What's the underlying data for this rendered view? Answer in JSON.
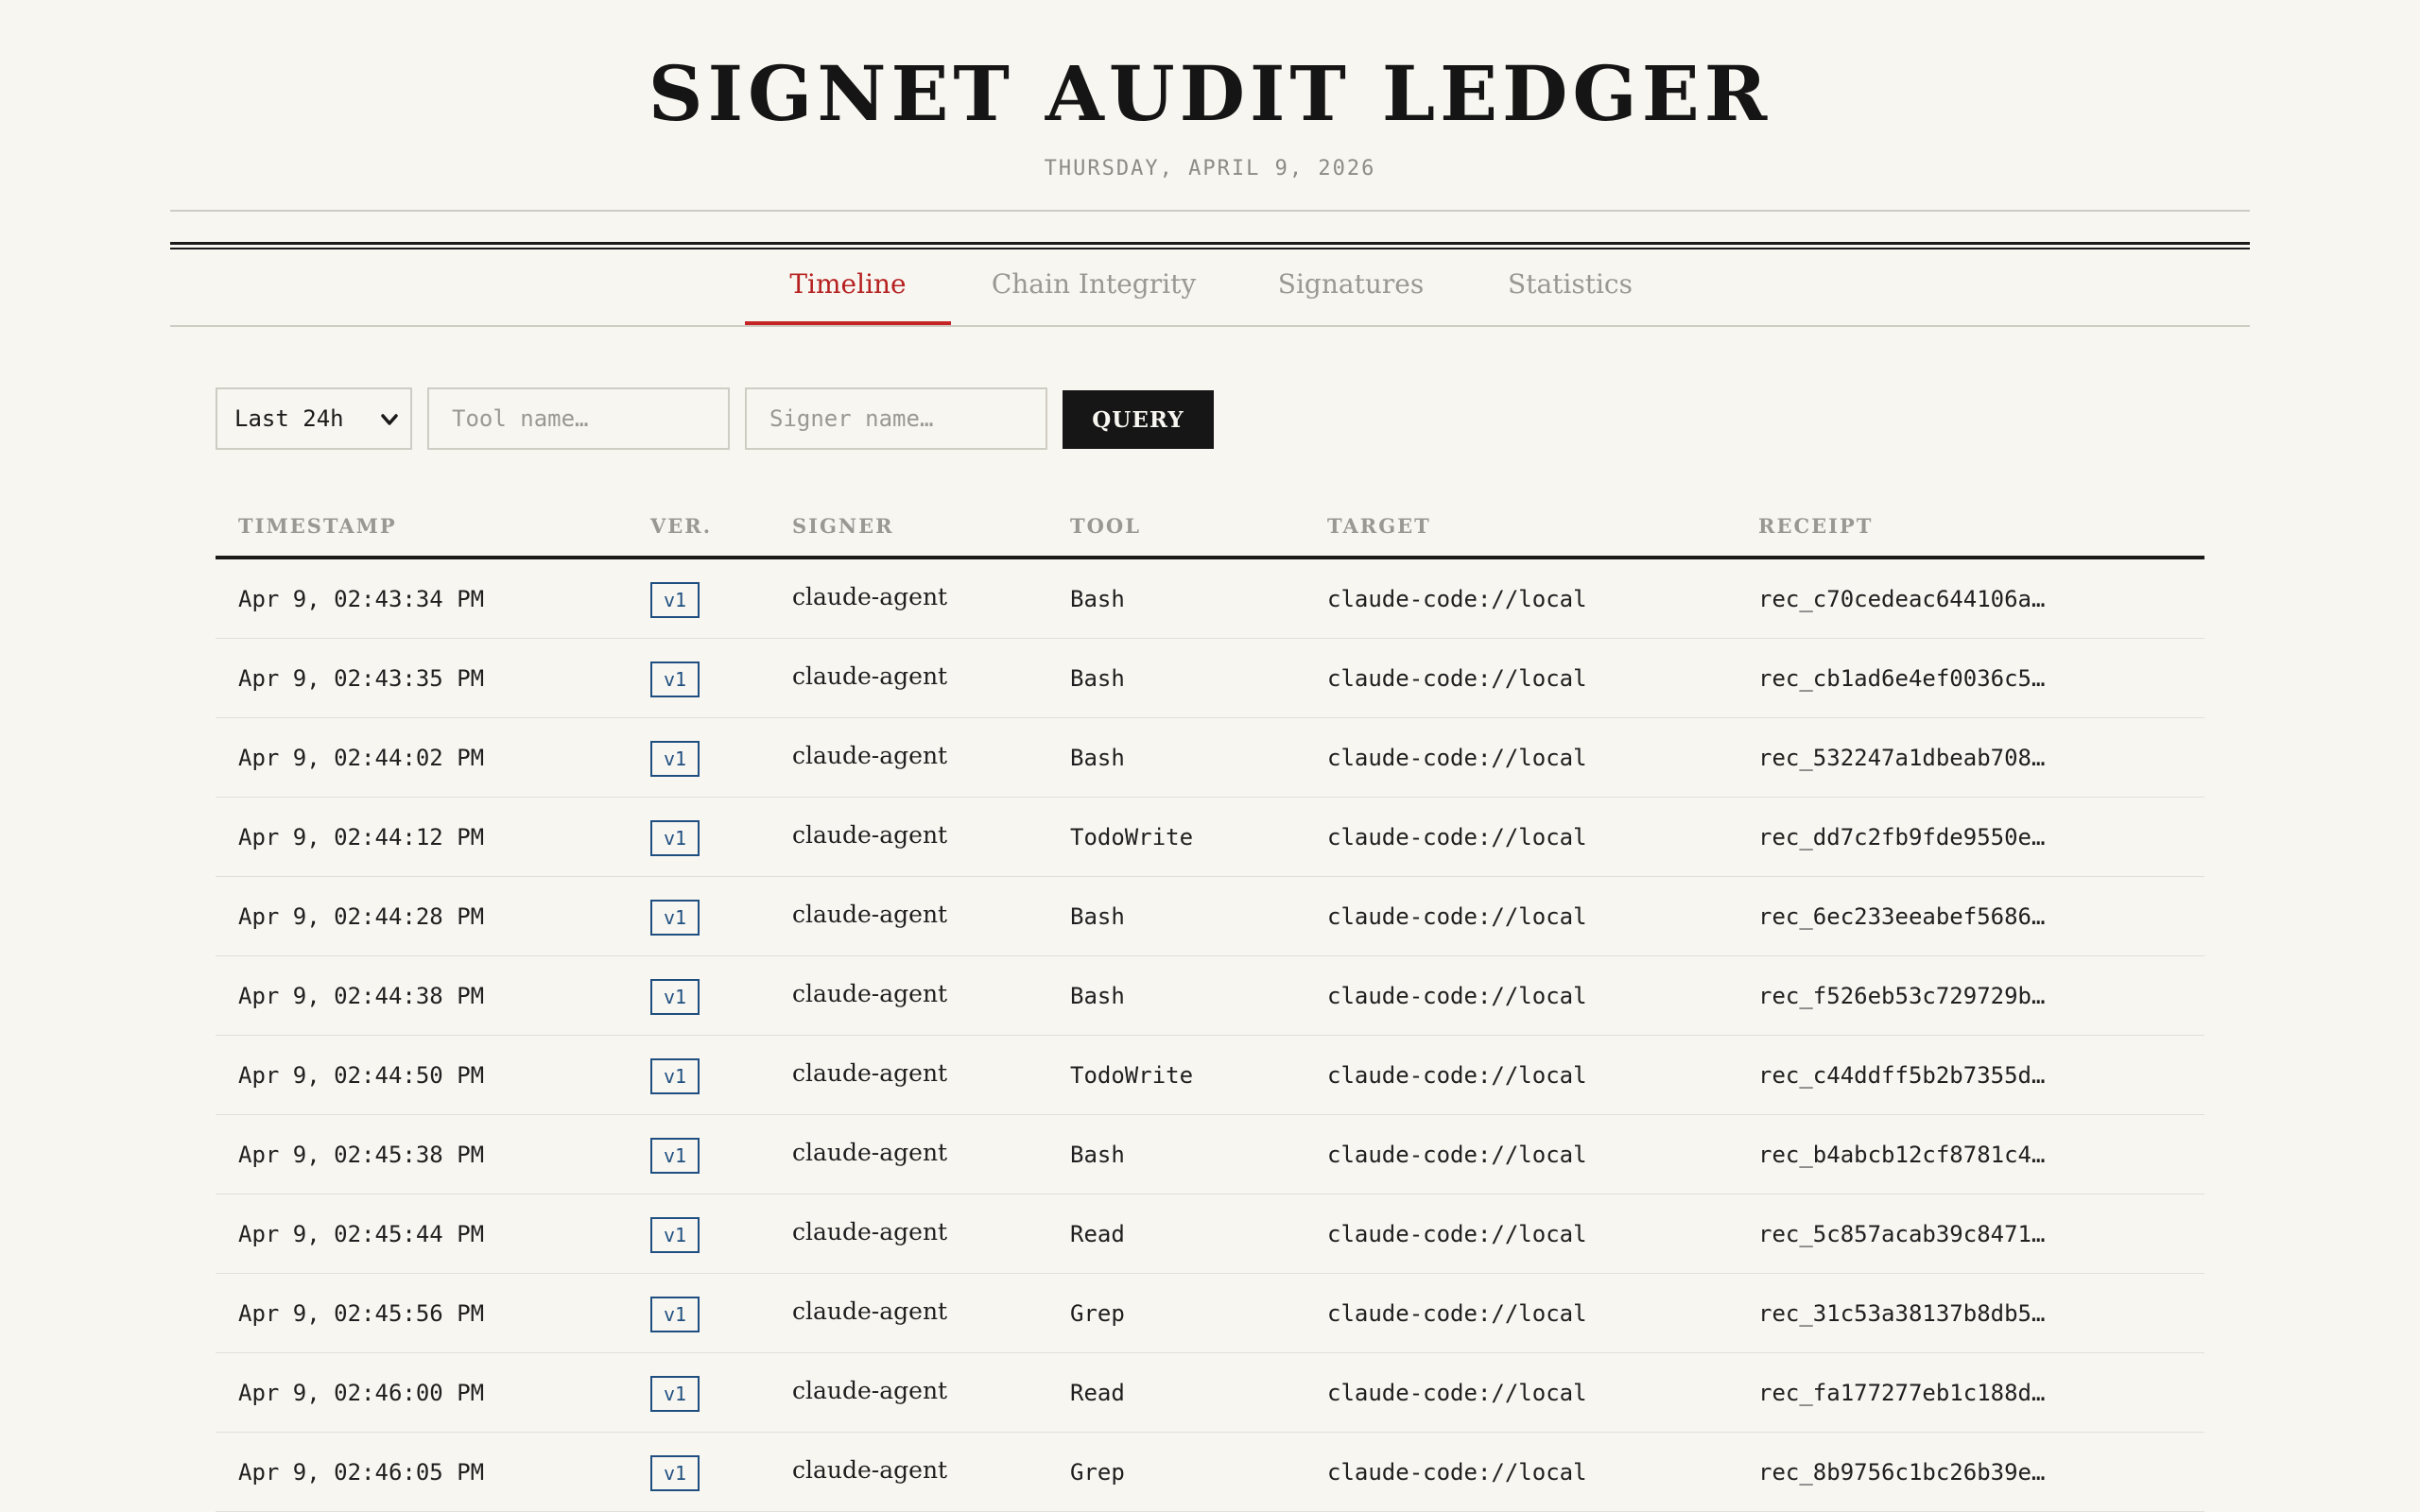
{
  "header": {
    "title": "SIGNET AUDIT LEDGER",
    "date": "THURSDAY, APRIL 9, 2026"
  },
  "tabs": [
    {
      "label": "Timeline",
      "active": true
    },
    {
      "label": "Chain Integrity",
      "active": false
    },
    {
      "label": "Signatures",
      "active": false
    },
    {
      "label": "Statistics",
      "active": false
    }
  ],
  "filters": {
    "range_value": "Last 24h",
    "tool_placeholder": "Tool name…",
    "signer_placeholder": "Signer name…",
    "query_label": "QUERY"
  },
  "table": {
    "columns": [
      "TIMESTAMP",
      "VER.",
      "SIGNER",
      "TOOL",
      "TARGET",
      "RECEIPT"
    ],
    "rows": [
      {
        "timestamp": "Apr 9, 02:43:34 PM",
        "ver": "v1",
        "signer": "claude-agent",
        "tool": "Bash",
        "target": "claude-code://local",
        "receipt": "rec_c70cedeac644106a…"
      },
      {
        "timestamp": "Apr 9, 02:43:35 PM",
        "ver": "v1",
        "signer": "claude-agent",
        "tool": "Bash",
        "target": "claude-code://local",
        "receipt": "rec_cb1ad6e4ef0036c5…"
      },
      {
        "timestamp": "Apr 9, 02:44:02 PM",
        "ver": "v1",
        "signer": "claude-agent",
        "tool": "Bash",
        "target": "claude-code://local",
        "receipt": "rec_532247a1dbeab708…"
      },
      {
        "timestamp": "Apr 9, 02:44:12 PM",
        "ver": "v1",
        "signer": "claude-agent",
        "tool": "TodoWrite",
        "target": "claude-code://local",
        "receipt": "rec_dd7c2fb9fde9550e…"
      },
      {
        "timestamp": "Apr 9, 02:44:28 PM",
        "ver": "v1",
        "signer": "claude-agent",
        "tool": "Bash",
        "target": "claude-code://local",
        "receipt": "rec_6ec233eeabef5686…"
      },
      {
        "timestamp": "Apr 9, 02:44:38 PM",
        "ver": "v1",
        "signer": "claude-agent",
        "tool": "Bash",
        "target": "claude-code://local",
        "receipt": "rec_f526eb53c729729b…"
      },
      {
        "timestamp": "Apr 9, 02:44:50 PM",
        "ver": "v1",
        "signer": "claude-agent",
        "tool": "TodoWrite",
        "target": "claude-code://local",
        "receipt": "rec_c44ddff5b2b7355d…"
      },
      {
        "timestamp": "Apr 9, 02:45:38 PM",
        "ver": "v1",
        "signer": "claude-agent",
        "tool": "Bash",
        "target": "claude-code://local",
        "receipt": "rec_b4abcb12cf8781c4…"
      },
      {
        "timestamp": "Apr 9, 02:45:44 PM",
        "ver": "v1",
        "signer": "claude-agent",
        "tool": "Read",
        "target": "claude-code://local",
        "receipt": "rec_5c857acab39c8471…"
      },
      {
        "timestamp": "Apr 9, 02:45:56 PM",
        "ver": "v1",
        "signer": "claude-agent",
        "tool": "Grep",
        "target": "claude-code://local",
        "receipt": "rec_31c53a38137b8db5…"
      },
      {
        "timestamp": "Apr 9, 02:46:00 PM",
        "ver": "v1",
        "signer": "claude-agent",
        "tool": "Read",
        "target": "claude-code://local",
        "receipt": "rec_fa177277eb1c188d…"
      },
      {
        "timestamp": "Apr 9, 02:46:05 PM",
        "ver": "v1",
        "signer": "claude-agent",
        "tool": "Grep",
        "target": "claude-code://local",
        "receipt": "rec_8b9756c1bc26b39e…"
      }
    ]
  }
}
